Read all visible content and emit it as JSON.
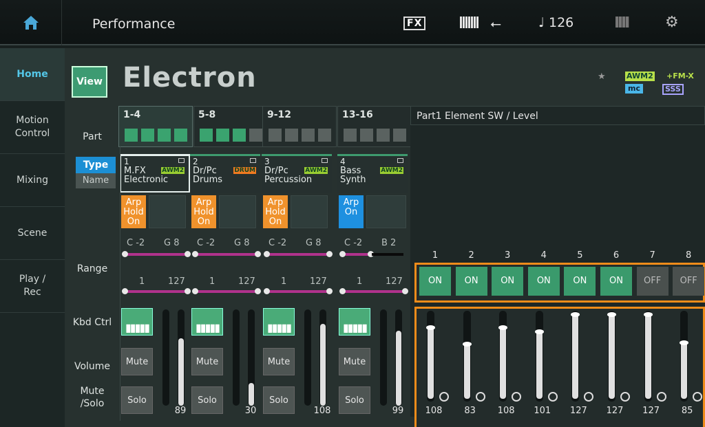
{
  "header": {
    "title": "Performance",
    "fx_label": "FX",
    "tempo": "♩ 126"
  },
  "nav": {
    "items": [
      "Home",
      "Motion Control",
      "Mixing",
      "Scene",
      "Play / Rec"
    ],
    "active": 0
  },
  "view_label": "View",
  "performance_name": "Electron",
  "logos": {
    "awm": "AWM2",
    "fmx": "+FM-X",
    "mc": "mc",
    "sss": "SSS"
  },
  "labels": {
    "part": "Part",
    "type": "Type",
    "name": "Name",
    "range": "Range",
    "kbd_ctrl": "Kbd Ctrl",
    "volume": "Volume",
    "mute_solo": "Mute /Solo",
    "element_header": "Part1 Element SW / Level",
    "mute": "Mute",
    "solo": "Solo"
  },
  "part_tabs": [
    "1-4",
    "5-8",
    "9-12",
    "13-16"
  ],
  "parts": [
    {
      "num": "1",
      "type": "M.FX",
      "name": "Electronic",
      "badge": "AWM2",
      "badge_color": "#9acd32",
      "arp": "Arp Hold On",
      "arp_color": "#f0922c",
      "note_low": "C -2",
      "note_high": "G 8",
      "vel_low": "1",
      "vel_high": "127",
      "volume": "89"
    },
    {
      "num": "2",
      "type": "Dr/Pc",
      "name": "Drums",
      "badge": "DRUM",
      "badge_color": "#f07a20",
      "arp": "Arp Hold On",
      "arp_color": "#f0922c",
      "note_low": "C -2",
      "note_high": "G 8",
      "vel_low": "1",
      "vel_high": "127",
      "volume": "30"
    },
    {
      "num": "3",
      "type": "Dr/Pc",
      "name": "Percussion",
      "badge": "AWM2",
      "badge_color": "#9acd32",
      "arp": "Arp Hold On",
      "arp_color": "#f0922c",
      "note_low": "C -2",
      "note_high": "G 8",
      "vel_low": "1",
      "vel_high": "127",
      "volume": "108"
    },
    {
      "num": "4",
      "type": "Bass",
      "name": "Synth",
      "badge": "AWM2",
      "badge_color": "#9acd32",
      "arp": "Arp On",
      "arp_color": "#1e90e0",
      "note_low": "C -2",
      "note_high": "B 2",
      "vel_low": "1",
      "vel_high": "127",
      "volume": "99"
    }
  ],
  "elements": [
    {
      "num": "1",
      "sw": "ON",
      "level": "108"
    },
    {
      "num": "2",
      "sw": "ON",
      "level": "83"
    },
    {
      "num": "3",
      "sw": "ON",
      "level": "108"
    },
    {
      "num": "4",
      "sw": "ON",
      "level": "101"
    },
    {
      "num": "5",
      "sw": "ON",
      "level": "127"
    },
    {
      "num": "6",
      "sw": "ON",
      "level": "127"
    },
    {
      "num": "7",
      "sw": "OFF",
      "level": "127"
    },
    {
      "num": "8",
      "sw": "OFF",
      "level": "85"
    }
  ],
  "colors": {
    "on": "#3a9a6c",
    "off": "#4a504e",
    "accent_orange": "#f08c1a",
    "nav_active": "#54c7e8"
  }
}
